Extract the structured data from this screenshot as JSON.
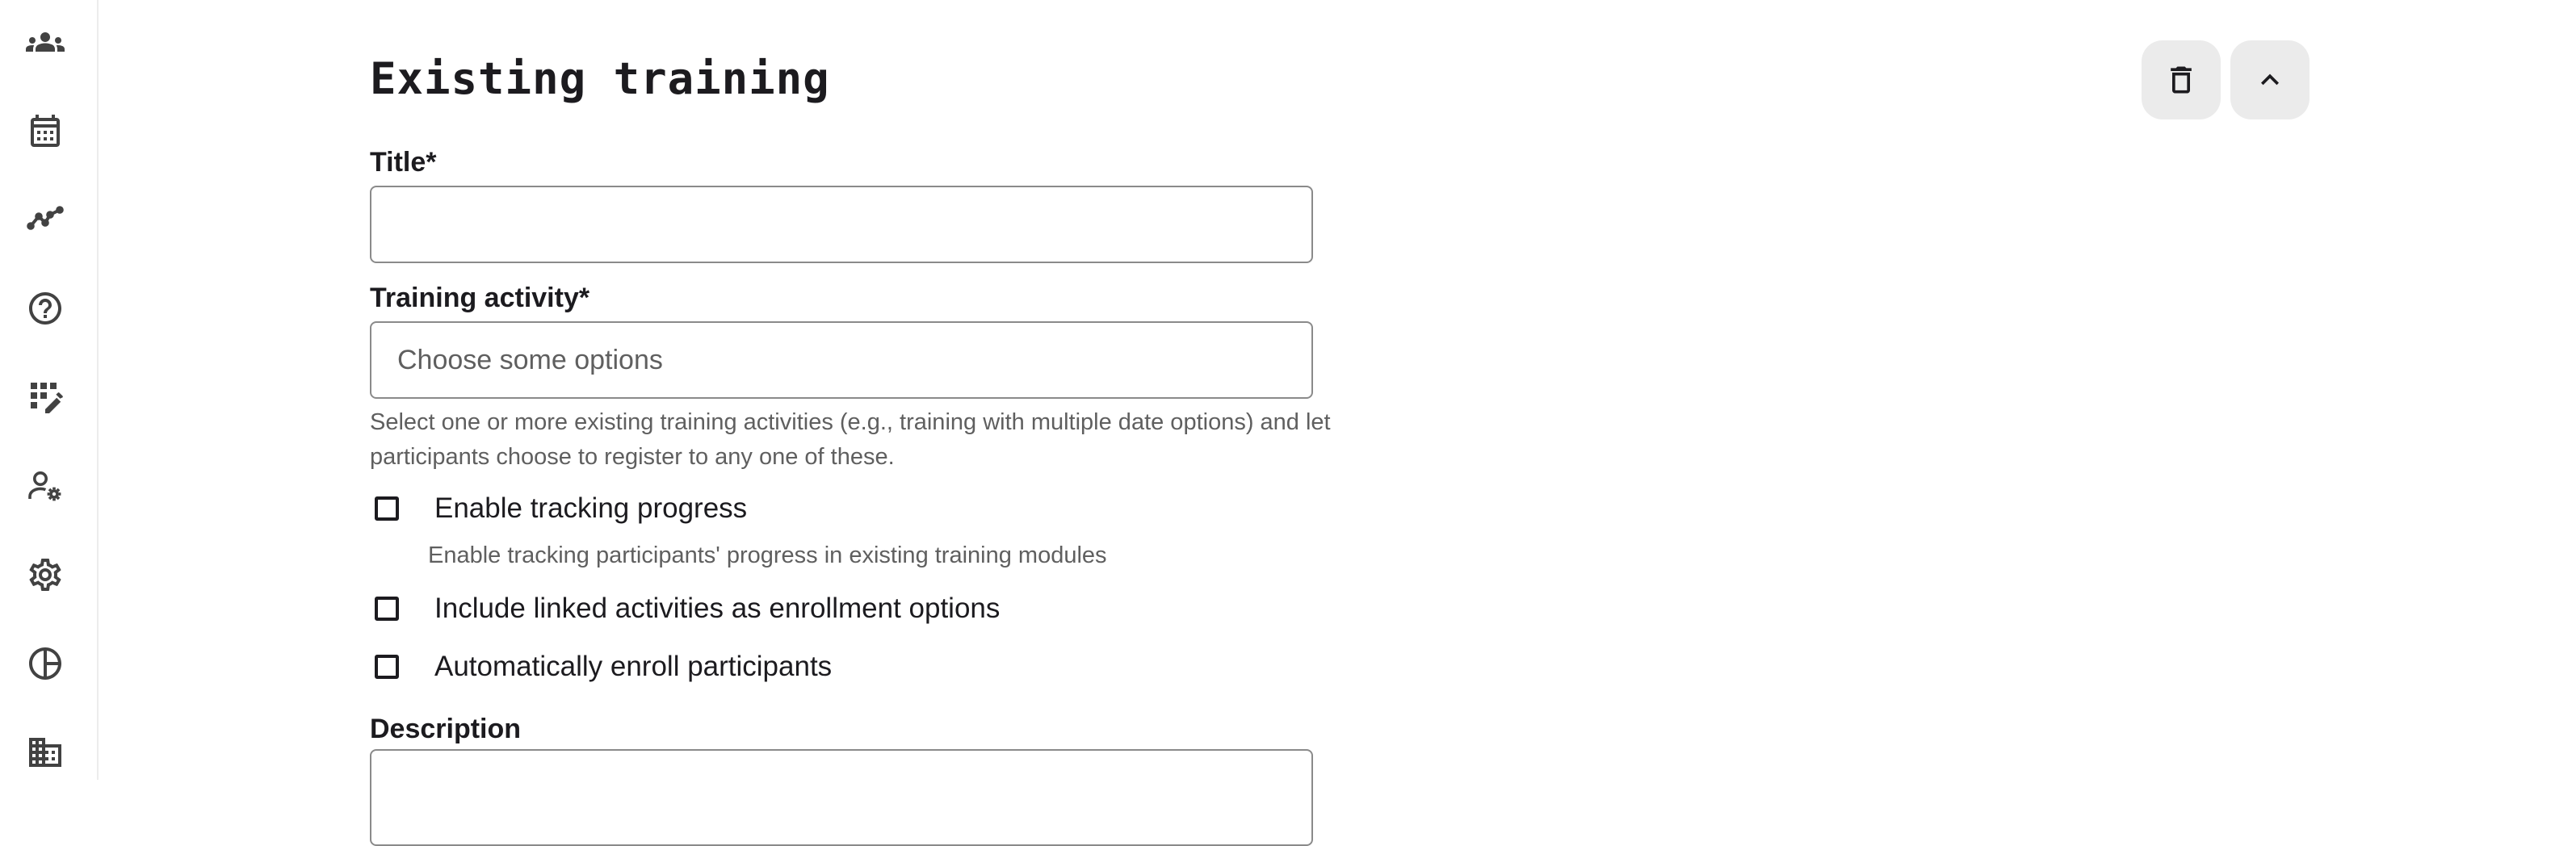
{
  "sidebar": {
    "items": [
      {
        "icon": "groups-icon"
      },
      {
        "icon": "calendar-icon"
      },
      {
        "icon": "analytics-icon"
      },
      {
        "icon": "help-icon"
      },
      {
        "icon": "edit-grid-icon"
      },
      {
        "icon": "user-settings-icon"
      },
      {
        "icon": "gear-icon"
      },
      {
        "icon": "pie-chart-icon"
      },
      {
        "icon": "building-icon"
      }
    ]
  },
  "header": {
    "title": "Existing training",
    "delete_icon": "trash-icon",
    "collapse_icon": "chevron-up-icon"
  },
  "form": {
    "title_label": "Title*",
    "title_value": "",
    "activity_label": "Training activity*",
    "activity_placeholder": "Choose some options",
    "activity_helper": "Select one or more existing training activities (e.g., training with multiple date options) and let participants choose to register to any one of these.",
    "tracking_label": "Enable tracking progress",
    "tracking_checked": false,
    "tracking_helper": "Enable tracking participants' progress in existing training modules",
    "linked_label": "Include linked activities as enrollment options",
    "linked_checked": false,
    "auto_enroll_label": "Automatically enroll participants",
    "auto_enroll_checked": false,
    "description_label": "Description"
  },
  "colors": {
    "button_bg": "#ebebeb",
    "text_primary": "#1c1b1f",
    "text_secondary": "#5f5f5f",
    "border": "#8a8a8a"
  }
}
